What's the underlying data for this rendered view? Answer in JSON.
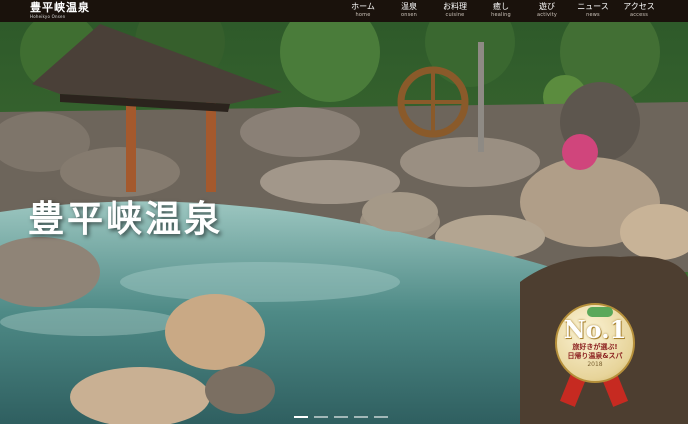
{
  "header": {
    "logo_main": "豊平峡温泉",
    "logo_sub": "Hoheikyo Onsen"
  },
  "nav": [
    {
      "jp": "ホーム",
      "en": "home"
    },
    {
      "jp": "温泉",
      "en": "onsen"
    },
    {
      "jp": "お料理",
      "en": "cuisine"
    },
    {
      "jp": "癒し",
      "en": "healing"
    },
    {
      "jp": "遊び",
      "en": "activity"
    },
    {
      "jp": "ニュース",
      "en": "news"
    },
    {
      "jp": "アクセス",
      "en": "access"
    }
  ],
  "hero": {
    "title": "豊平峡温泉",
    "badge": {
      "rank": "No.1",
      "line1": "旅好きが選ぶ!",
      "line2": "日帰り温泉&スパ",
      "year": "2018"
    },
    "slides": 5,
    "active_slide": 0
  },
  "colors": {
    "header_bg": "#1a120c",
    "water": "#4e8a86",
    "ribbon": "#c62a21"
  }
}
